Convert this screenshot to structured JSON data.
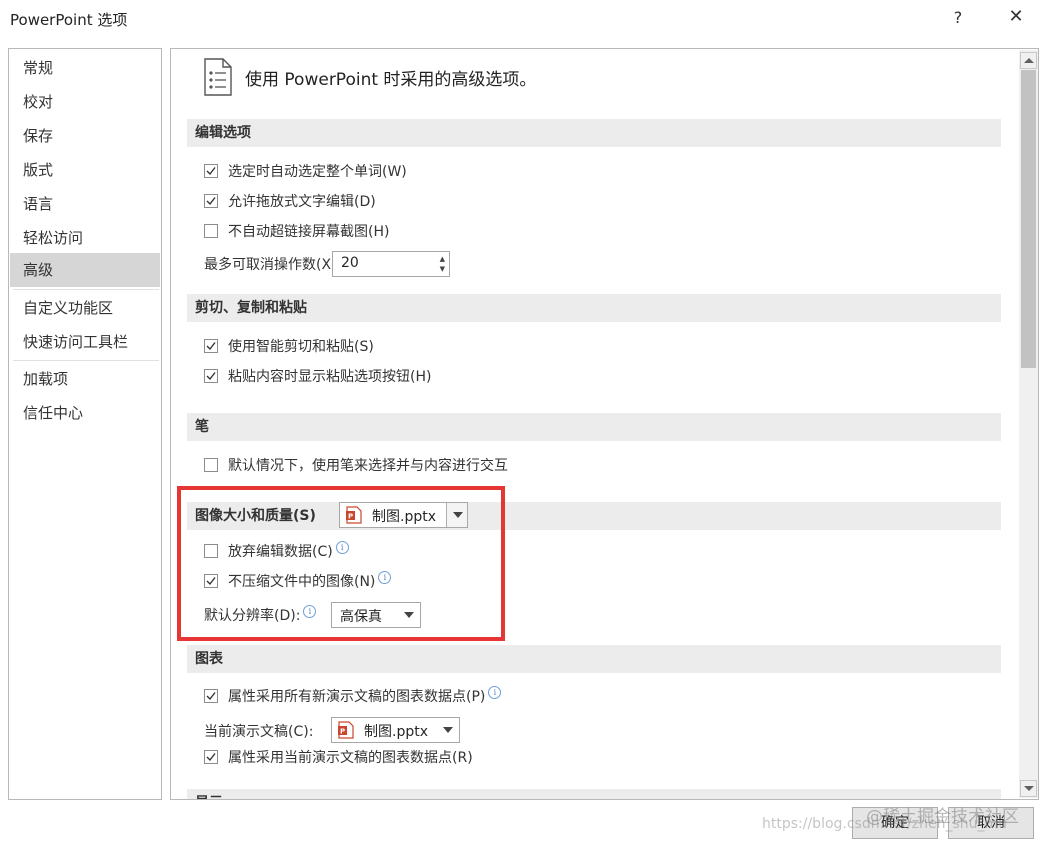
{
  "window": {
    "title": "PowerPoint 选项",
    "help": "?",
    "close": "✕"
  },
  "sidebar": {
    "items": [
      {
        "label": "常规"
      },
      {
        "label": "校对"
      },
      {
        "label": "保存"
      },
      {
        "label": "版式"
      },
      {
        "label": "语言"
      },
      {
        "label": "轻松访问"
      },
      {
        "label": "高级"
      },
      {
        "label": "自定义功能区"
      },
      {
        "label": "快速访问工具栏"
      },
      {
        "label": "加载项"
      },
      {
        "label": "信任中心"
      }
    ],
    "active": "高级"
  },
  "intro": {
    "text": "使用 PowerPoint 时采用的高级选项。"
  },
  "editing": {
    "heading": "编辑选项",
    "opt1": "选定时自动选定整个单词(W)",
    "opt2": "允许拖放式文字编辑(D)",
    "opt3": "不自动超链接屏幕截图(H)",
    "undo_label": "最多可取消操作数(X):",
    "undo_value": "20"
  },
  "clipboard": {
    "heading": "剪切、复制和粘贴",
    "opt1": "使用智能剪切和粘贴(S)",
    "opt2": "粘贴内容时显示粘贴选项按钮(H)"
  },
  "pen": {
    "heading": "笔",
    "opt1": "默认情况下，使用笔来选择并与内容进行交互"
  },
  "image": {
    "heading": "图像大小和质量(S)",
    "file": "制图.pptx",
    "opt1": "放弃编辑数据(C)",
    "opt2": "不压缩文件中的图像(N)",
    "res_label": "默认分辨率(D):",
    "res_value": "高保真"
  },
  "chart": {
    "heading": "图表",
    "opt1": "属性采用所有新演示文稿的图表数据点(P)",
    "current_label": "当前演示文稿(C):",
    "current_file": "制图.pptx",
    "opt2": "属性采用当前演示文稿的图表数据点(R)"
  },
  "next_section": {
    "heading": "显示"
  },
  "buttons": {
    "ok": "确定",
    "cancel": "取消"
  },
  "watermark": {
    "line1": "https://blog.csdn.net/zhen_shu_mu",
    "line2": "@稀土掘金技术社区"
  },
  "colors": {
    "highlight": "#e53535",
    "active_nav": "#d6d6d6",
    "section_bg": "#ececec",
    "ppt_orange": "#c9472d"
  }
}
